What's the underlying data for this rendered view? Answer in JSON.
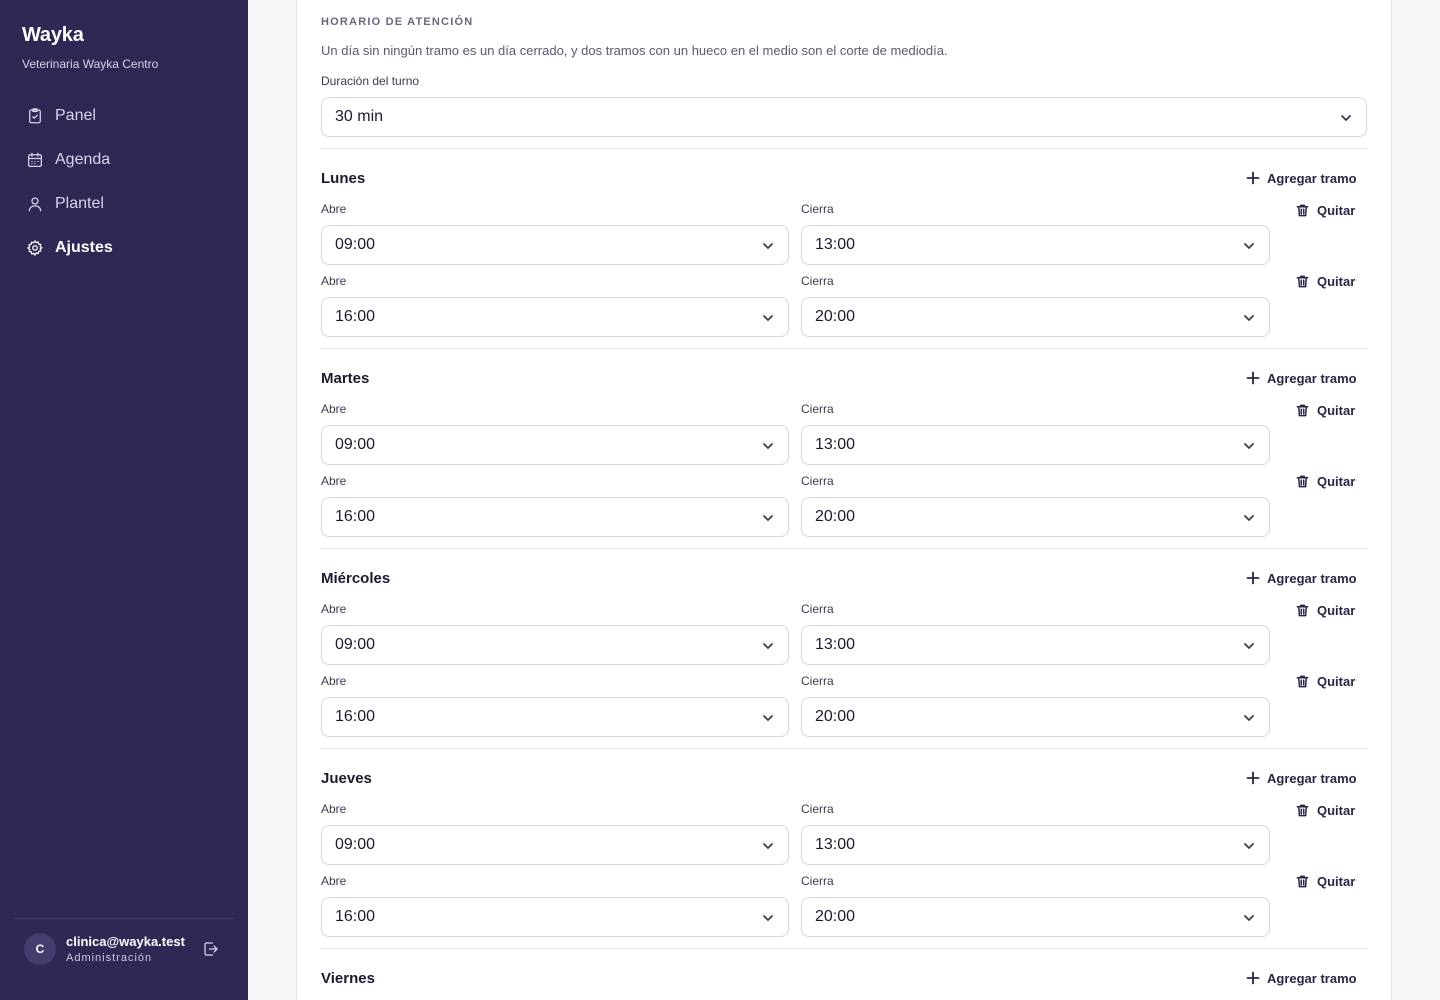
{
  "app": {
    "brand": "Wayka",
    "clinic": "Veterinaria Wayka Centro"
  },
  "sidebar": {
    "items": [
      {
        "label": "Panel",
        "icon": "clipboard-icon",
        "active": false
      },
      {
        "label": "Agenda",
        "icon": "calendar-icon",
        "active": false
      },
      {
        "label": "Plantel",
        "icon": "user-icon",
        "active": false
      },
      {
        "label": "Ajustes",
        "icon": "gear-icon",
        "active": true
      }
    ]
  },
  "user": {
    "initial": "C",
    "email": "clinica@wayka.test",
    "role": "Administración"
  },
  "schedule": {
    "section_title": "HORARIO DE ATENCIÓN",
    "description": "Un día sin ningún tramo es un día cerrado, y dos tramos con un hueco en el medio son el corte de mediodía.",
    "duration_label": "Duración del turno",
    "duration_value": "30 min",
    "add_label": "Agregar tramo",
    "remove_label": "Quitar",
    "open_label": "Abre",
    "close_label": "Cierra",
    "days": [
      {
        "name": "Lunes",
        "ranges": [
          {
            "open": "09:00",
            "close": "13:00"
          },
          {
            "open": "16:00",
            "close": "20:00"
          }
        ]
      },
      {
        "name": "Martes",
        "ranges": [
          {
            "open": "09:00",
            "close": "13:00"
          },
          {
            "open": "16:00",
            "close": "20:00"
          }
        ]
      },
      {
        "name": "Miércoles",
        "ranges": [
          {
            "open": "09:00",
            "close": "13:00"
          },
          {
            "open": "16:00",
            "close": "20:00"
          }
        ]
      },
      {
        "name": "Jueves",
        "ranges": [
          {
            "open": "09:00",
            "close": "13:00"
          },
          {
            "open": "16:00",
            "close": "20:00"
          }
        ]
      },
      {
        "name": "Viernes",
        "ranges": []
      }
    ]
  },
  "colors": {
    "sidebar_bg": "#2f2754",
    "text_primary": "#1c1a2e",
    "border": "#d8d7df"
  }
}
